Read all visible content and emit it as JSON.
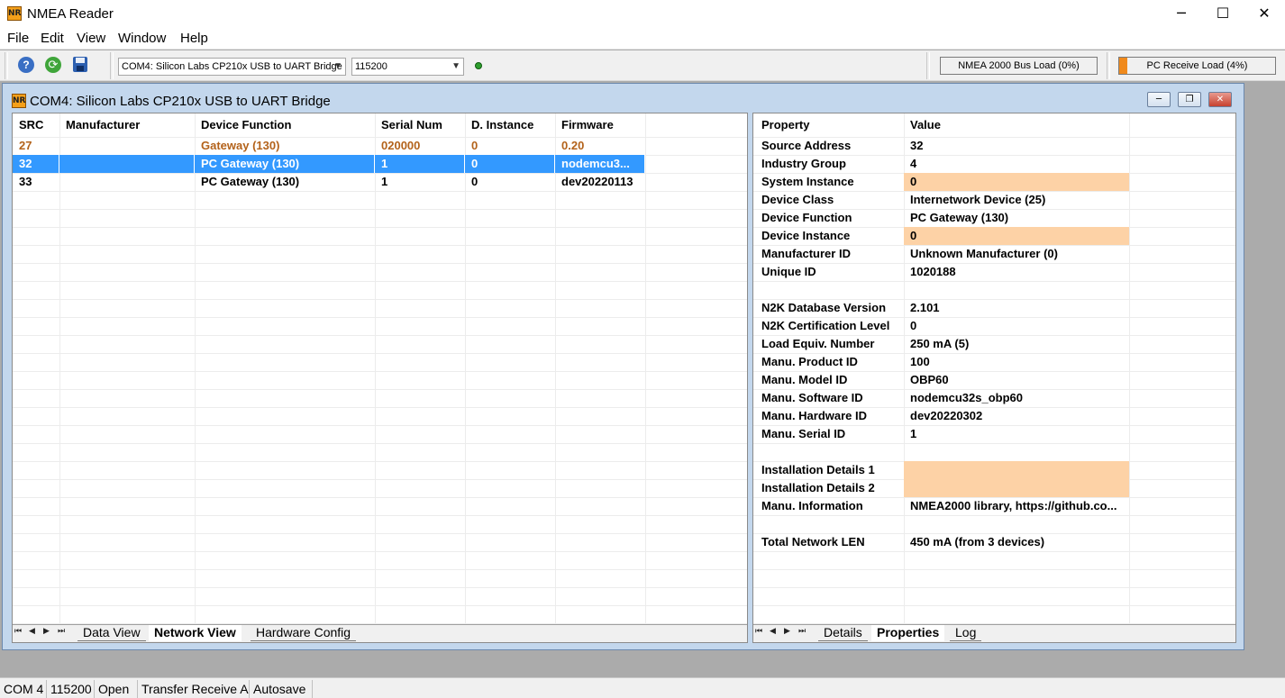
{
  "app": {
    "title": "NMEA Reader",
    "logo_text": "NR"
  },
  "window_controls": {
    "minimize": "─",
    "maximize": "☐",
    "close": "✕"
  },
  "menu": [
    "File",
    "Edit",
    "View",
    "Window",
    "Help"
  ],
  "toolbar": {
    "icons": [
      "help-icon",
      "refresh-icon",
      "save-icon"
    ],
    "port": "COM4: Silicon Labs CP210x USB to UART Bridge",
    "baud": "115200",
    "bus_load": "NMEA 2000 Bus Load (0%)",
    "pc_load": "PC Receive Load (4%)",
    "pc_load_fraction": 0.04
  },
  "child": {
    "title": "COM4: Silicon Labs CP210x USB to UART Bridge",
    "buttons": {
      "minimize": "─",
      "restore": "❐",
      "close": "✕"
    }
  },
  "network": {
    "columns": [
      "SRC",
      "Manufacturer",
      "Device Function",
      "Serial Num",
      "D. Instance",
      "Firmware"
    ],
    "rows": [
      [
        "27",
        "",
        "Gateway (130)",
        "020000",
        "0",
        "0.20"
      ],
      [
        "32",
        "",
        "PC Gateway (130)",
        "1",
        "0",
        "nodemcu3..."
      ],
      [
        "33",
        "",
        "PC Gateway (130)",
        "1",
        "0",
        "dev20220113"
      ]
    ],
    "tabs": [
      "Data View",
      "Network View",
      "Hardware Config"
    ]
  },
  "properties": {
    "columns": [
      "Property",
      "Value"
    ],
    "rows": [
      [
        "Source Address",
        "32"
      ],
      [
        "Industry Group",
        "4"
      ],
      [
        "System Instance",
        "0"
      ],
      [
        "Device Class",
        "Internetwork Device (25)"
      ],
      [
        "Device Function",
        "PC Gateway (130)"
      ],
      [
        "Device Instance",
        "0"
      ],
      [
        "Manufacturer ID",
        "Unknown Manufacturer (0)"
      ],
      [
        "Unique ID",
        "1020188"
      ],
      [
        "",
        ""
      ],
      [
        "N2K Database Version",
        "2.101"
      ],
      [
        "N2K Certification Level",
        "0"
      ],
      [
        "Load Equiv. Number",
        "250 mA (5)"
      ],
      [
        "Manu. Product ID",
        "100"
      ],
      [
        "Manu. Model ID",
        "OBP60"
      ],
      [
        "Manu. Software ID",
        "nodemcu32s_obp60"
      ],
      [
        "Manu. Hardware ID",
        "dev20220302"
      ],
      [
        "Manu. Serial ID",
        "1"
      ],
      [
        "",
        ""
      ],
      [
        "Installation Details 1",
        ""
      ],
      [
        "Installation Details 2",
        ""
      ],
      [
        "Manu. Information",
        "NMEA2000 library, https://github.co..."
      ],
      [
        "",
        ""
      ],
      [
        "Total Network LEN",
        "450 mA (from 3 devices)"
      ]
    ],
    "tabs": [
      "Details",
      "Properties",
      "Log"
    ]
  },
  "status": [
    "COM 4",
    "115200",
    "Open",
    "Transfer Receive A",
    "Autosave"
  ],
  "colors": {
    "selection": "#3399ff",
    "highlight_row": "#b3621a",
    "editable_cell": "#fdd2a6"
  }
}
